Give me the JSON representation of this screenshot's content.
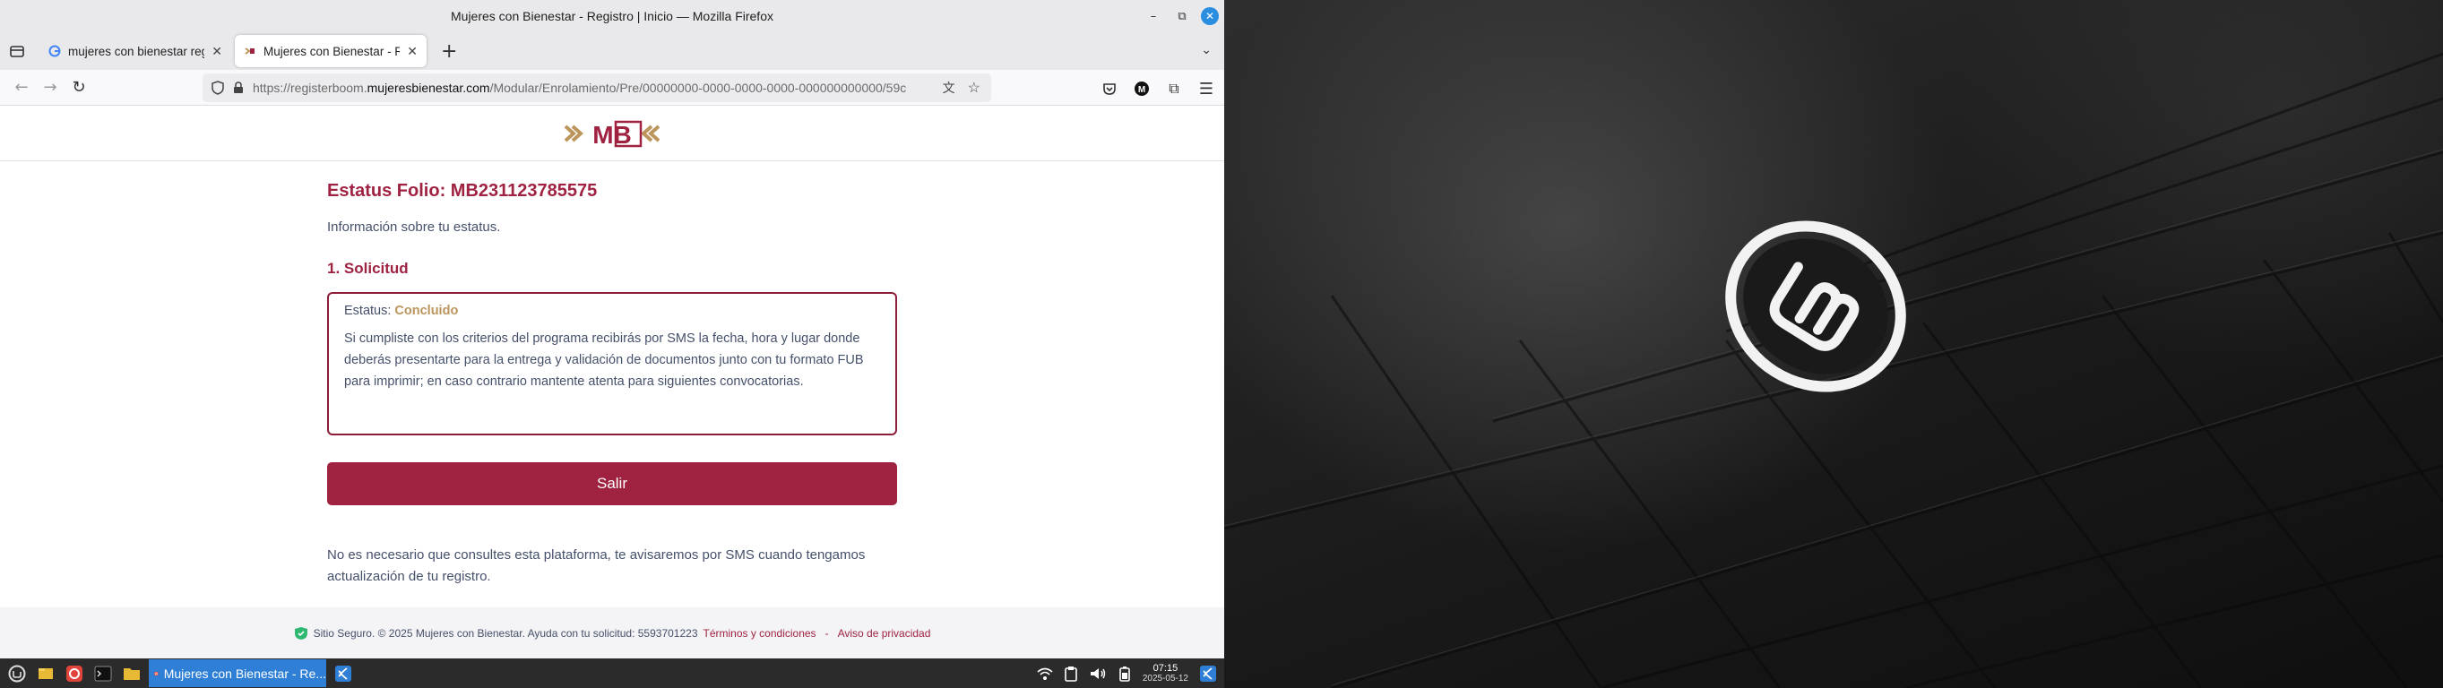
{
  "window": {
    "title": "Mujeres con Bienestar - Registro | Inicio — Mozilla Firefox"
  },
  "tabs": [
    {
      "label": "mujeres con bienestar regis",
      "favicon": "google-icon",
      "active": false
    },
    {
      "label": "Mujeres con Bienestar - Reg",
      "favicon": "mb-favicon",
      "active": true
    }
  ],
  "navbar": {
    "url_prefix": "https://registerboom.",
    "url_domain": "mujeresbienestar.com",
    "url_path": "/Modular/Enrolamiento/Pre/00000000-0000-0000-0000-000000000000/59c"
  },
  "page": {
    "logo_text": "MB",
    "folio_title": "Estatus Folio: MB231123785575",
    "subtitle": "Información sobre tu estatus.",
    "section_title": "1. Solicitud",
    "status_label": "Estatus:",
    "status_value": "Concluido",
    "status_description": "Si cumpliste con los criterios del programa recibirás por SMS la fecha, hora y lugar donde deberás presentarte para la entrega y validación de documentos junto con tu formato FUB para imprimir; en caso contrario mantente atenta para siguientes convocatorias.",
    "exit_button": "Salir",
    "notice": "No es necesario que consultes esta plataforma, te avisaremos por SMS cuando tengamos actualización de tu registro."
  },
  "footer": {
    "text": "Sitio Seguro. © 2025 Mujeres con Bienestar. Ayuda con tu solicitud: 5593701223",
    "terms_link": "Términos y condiciones",
    "separator": "-",
    "privacy_link": "Aviso de privacidad"
  },
  "taskbar": {
    "active_task": "Mujeres con Bienestar - Re...",
    "time": "07:15",
    "date": "2025-05-12"
  },
  "colors": {
    "brand_primary": "#9f2241",
    "brand_gold": "#bc955c",
    "text_body": "#45506a",
    "taskbar_accent": "#2f7fd6"
  }
}
